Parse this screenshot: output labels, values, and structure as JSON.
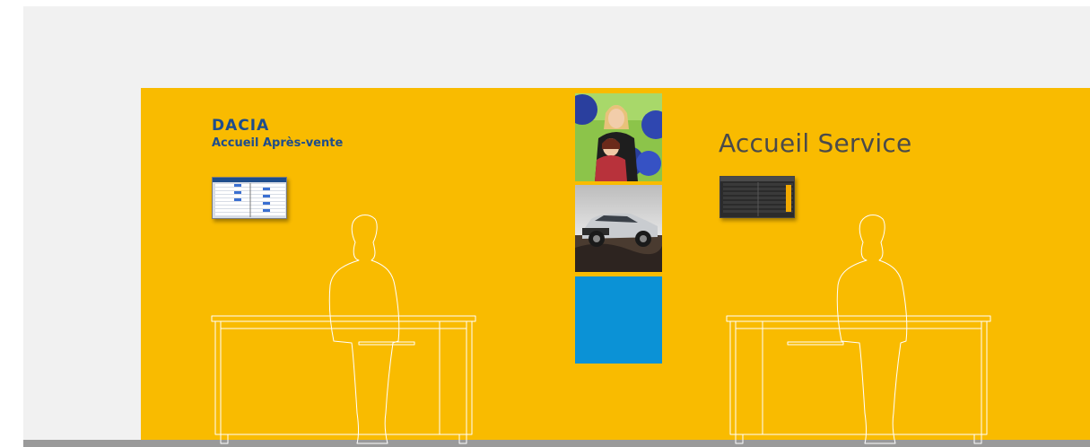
{
  "left_counter": {
    "brand": "DACIA",
    "subtitle": "Accueil Après-vente"
  },
  "right_counter": {
    "title": "Accueil Service"
  },
  "colors": {
    "wall": "#f9bb00",
    "brand_blue": "#1e4d8c",
    "panel_blue": "#0b92d6"
  },
  "icons": [
    "person-silhouette-icon",
    "counter-desk-icon",
    "display-screen-icon"
  ]
}
